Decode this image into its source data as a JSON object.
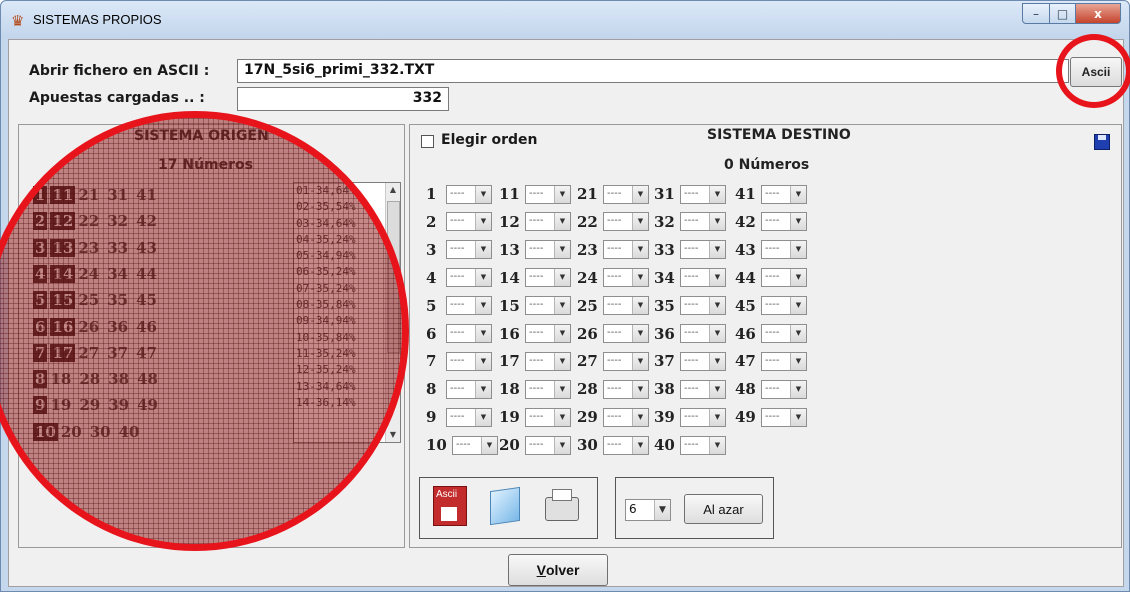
{
  "window": {
    "title": "SISTEMAS PROPIOS",
    "minimize": "–",
    "maximize": "□",
    "close": "x"
  },
  "header": {
    "file_label": "Abrir fichero en ASCII :",
    "file_value": "17N_5si6_primi_332.TXT",
    "ascii_button": "Ascii",
    "bets_label": "Apuestas cargadas .. :",
    "bets_value": "332"
  },
  "origin": {
    "title": "SISTEMA ORIGEN",
    "count_text": "17  Números",
    "rows": [
      {
        "sel": [
          "1",
          "11"
        ],
        "rest": [
          "21",
          "31",
          "41"
        ]
      },
      {
        "sel": [
          "2",
          "12"
        ],
        "rest": [
          "22",
          "32",
          "42"
        ]
      },
      {
        "sel": [
          "3",
          "13"
        ],
        "rest": [
          "23",
          "33",
          "43"
        ]
      },
      {
        "sel": [
          "4",
          "14"
        ],
        "rest": [
          "24",
          "34",
          "44"
        ]
      },
      {
        "sel": [
          "5",
          "15"
        ],
        "rest": [
          "25",
          "35",
          "45"
        ]
      },
      {
        "sel": [
          "6",
          "16"
        ],
        "rest": [
          "26",
          "36",
          "46"
        ]
      },
      {
        "sel": [
          "7",
          "17"
        ],
        "rest": [
          "27",
          "37",
          "47"
        ]
      },
      {
        "sel": [
          "8"
        ],
        "rest": [
          "18",
          "28",
          "38",
          "48"
        ]
      },
      {
        "sel": [
          "9"
        ],
        "rest": [
          "19",
          "29",
          "39",
          "49"
        ]
      },
      {
        "sel": [
          "10"
        ],
        "rest": [
          "20",
          "30",
          "40"
        ]
      }
    ],
    "list_items": [
      "01-34,64%",
      "02-35,54%",
      "03-34,64%",
      "04-35,24%",
      "05-34,94%",
      "06-35,24%",
      "07-35,24%",
      "08-35,84%",
      "09-34,94%",
      "10-35,84%",
      "11-35,24%",
      "12-35,24%",
      "13-34,64%",
      "14-36,14%"
    ]
  },
  "destination": {
    "checkbox_label": "Elegir orden",
    "title": "SISTEMA DESTINO",
    "count_text": "0  Números",
    "combo_value": "----",
    "columns": [
      [
        "1",
        "2",
        "3",
        "4",
        "5",
        "6",
        "7",
        "8",
        "9",
        "10"
      ],
      [
        "11",
        "12",
        "13",
        "14",
        "15",
        "16",
        "17",
        "18",
        "19",
        "20"
      ],
      [
        "21",
        "22",
        "23",
        "24",
        "25",
        "26",
        "27",
        "28",
        "29",
        "30"
      ],
      [
        "31",
        "32",
        "33",
        "34",
        "35",
        "36",
        "37",
        "38",
        "39",
        "40"
      ],
      [
        "41",
        "42",
        "43",
        "44",
        "45",
        "46",
        "47",
        "48",
        "49"
      ]
    ],
    "ascii_icon_label": "Ascii",
    "random_count": "6",
    "random_button": "Al azar"
  },
  "footer": {
    "back_button_underline": "V",
    "back_button_rest": "olver"
  }
}
